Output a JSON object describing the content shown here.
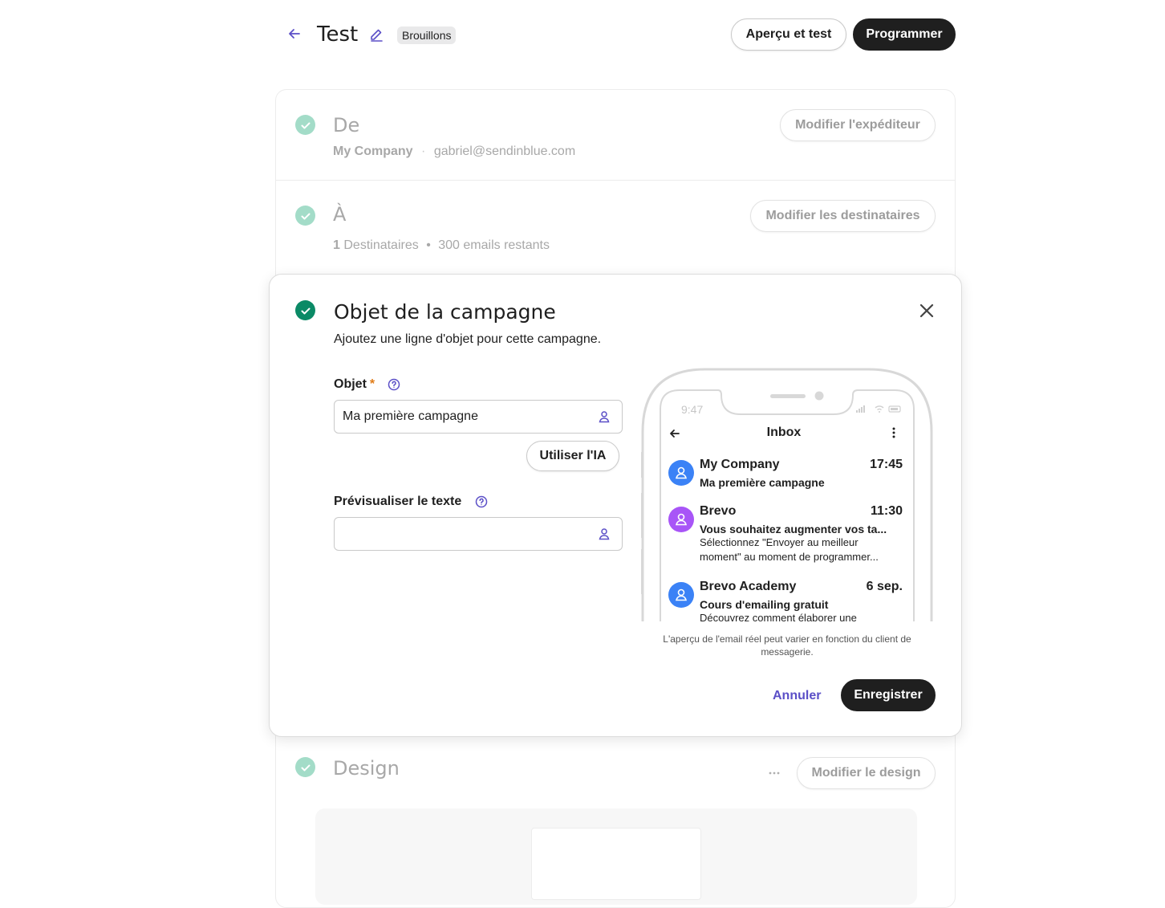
{
  "header": {
    "title": "Test",
    "status_badge": "Brouillons",
    "preview_button": "Aperçu et test",
    "schedule_button": "Programmer"
  },
  "sender_section": {
    "title": "De",
    "sender_name": "My Company",
    "sender_email": "gabriel@sendinblue.com",
    "edit_button": "Modifier l'expéditeur"
  },
  "recipients_section": {
    "title": "À",
    "recipient_count": "1",
    "recipient_label": "Destinataires",
    "emails_remaining": "300 emails restants",
    "edit_button": "Modifier les destinataires"
  },
  "subject_modal": {
    "title": "Objet de la campagne",
    "description": "Ajoutez une ligne d'objet pour cette campagne.",
    "subject_label": "Objet",
    "required_mark": "*",
    "subject_value": "Ma première campagne",
    "ai_button": "Utiliser l'IA",
    "preview_text_label": "Prévisualiser le texte",
    "preview_text_value": "",
    "caption": "L'aperçu de l'email réel peut varier en fonction du client de messagerie.",
    "cancel_button": "Annuler",
    "save_button": "Enregistrer"
  },
  "phone_preview": {
    "time": "9:47",
    "screen_title": "Inbox",
    "emails": [
      {
        "sender": "My Company",
        "time": "17:45",
        "subject": "Ma première campagne",
        "preview": "",
        "avatar_color": "#3b82f6"
      },
      {
        "sender": "Brevo",
        "time": "11:30",
        "subject": "Vous souhaitez augmenter vos ta...",
        "preview_line1": "Sélectionnez \"Envoyer au meilleur",
        "preview_line2": "moment\" au moment de programmer...",
        "avatar_color": "#a855f7"
      },
      {
        "sender": "Brevo Academy",
        "time": "6 sep.",
        "subject": "Cours d'emailing gratuit",
        "preview_line1": "Découvrez comment élaborer une",
        "avatar_color": "#3b82f6"
      }
    ]
  },
  "design_section": {
    "title": "Design",
    "edit_button": "Modifier le design"
  },
  "colors": {
    "accent": "#5b4fc7",
    "dark_button": "#1f1f1f",
    "check_done": "#0b8a66",
    "check_light": "#a3dcc8"
  }
}
